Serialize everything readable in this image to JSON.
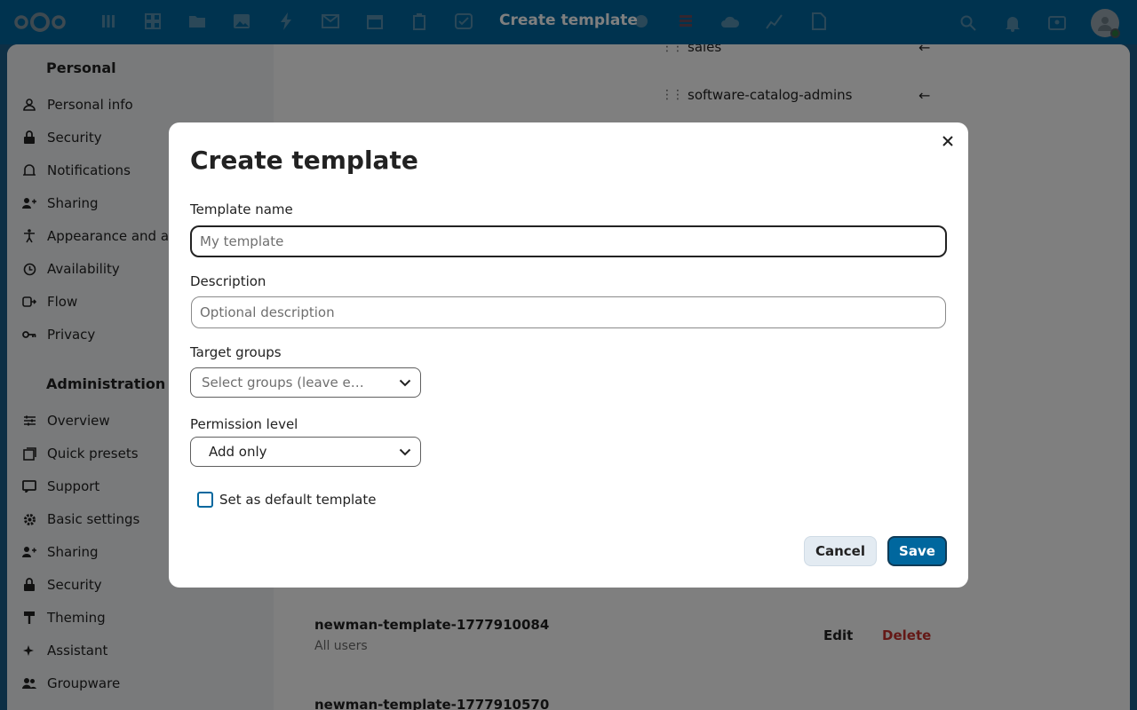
{
  "header": {
    "title": "Create template"
  },
  "sidebar": {
    "personal_heading": "Personal",
    "personal_items": [
      {
        "label": "Personal info",
        "icon": "user-icon"
      },
      {
        "label": "Security",
        "icon": "lock-icon"
      },
      {
        "label": "Notifications",
        "icon": "bell-icon"
      },
      {
        "label": "Sharing",
        "icon": "share-icon"
      },
      {
        "label": "Appearance and a",
        "icon": "accessibility-icon"
      },
      {
        "label": "Availability",
        "icon": "clock-icon"
      },
      {
        "label": "Flow",
        "icon": "flow-icon"
      },
      {
        "label": "Privacy",
        "icon": "key-icon"
      }
    ],
    "admin_heading": "Administration",
    "admin_items": [
      {
        "label": "Overview",
        "icon": "sliders-icon"
      },
      {
        "label": "Quick presets",
        "icon": "presets-icon"
      },
      {
        "label": "Support",
        "icon": "support-icon"
      },
      {
        "label": "Basic settings",
        "icon": "gear-icon"
      },
      {
        "label": "Sharing",
        "icon": "share-icon"
      },
      {
        "label": "Security",
        "icon": "lock-icon"
      },
      {
        "label": "Theming",
        "icon": "brush-icon"
      },
      {
        "label": "Assistant",
        "icon": "sparkle-icon"
      },
      {
        "label": "Groupware",
        "icon": "people-icon"
      }
    ]
  },
  "main": {
    "groups": [
      {
        "name": "sales"
      },
      {
        "name": "software-catalog-admins"
      }
    ],
    "templates": [
      {
        "name": "newman-template-1777910084",
        "sub": "All users",
        "edit": "Edit",
        "delete": "Delete"
      },
      {
        "name": "newman-template-1777910570"
      }
    ]
  },
  "modal": {
    "title": "Create template",
    "name_label": "Template name",
    "name_placeholder": "My template",
    "name_value": "",
    "description_label": "Description",
    "description_placeholder": "Optional description",
    "description_value": "",
    "groups_label": "Target groups",
    "groups_placeholder": "Select groups (leave e…",
    "permission_label": "Permission level",
    "permission_value": "Add only",
    "default_checkbox_label": "Set as default template",
    "default_checked": false,
    "cancel_label": "Cancel",
    "save_label": "Save"
  },
  "colors": {
    "brand": "#00679e",
    "danger": "#c9302c"
  }
}
